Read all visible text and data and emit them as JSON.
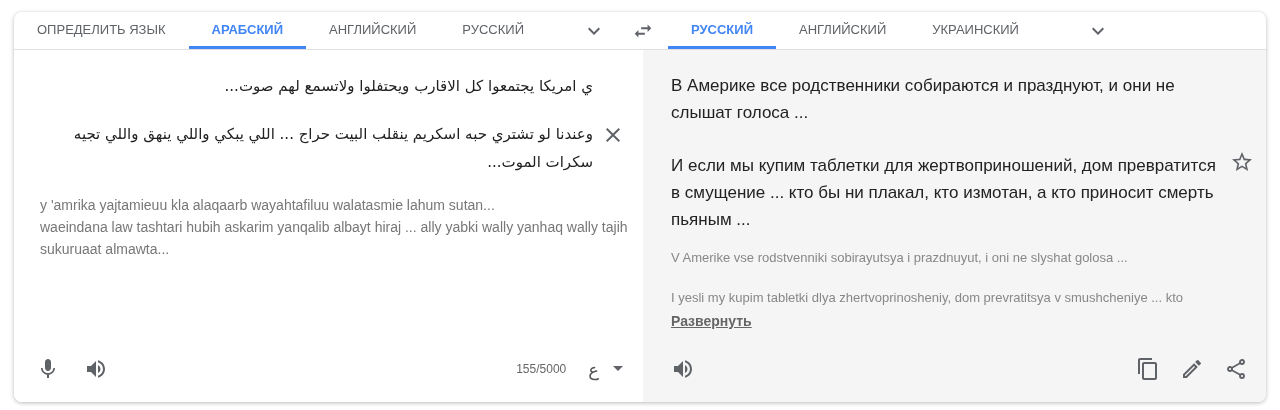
{
  "source_tabs": [
    {
      "label": "ОПРЕДЕЛИТЬ ЯЗЫК",
      "selected": false
    },
    {
      "label": "АРАБСКИЙ",
      "selected": true
    },
    {
      "label": "АНГЛИЙСКИЙ",
      "selected": false
    },
    {
      "label": "РУССКИЙ",
      "selected": false
    }
  ],
  "target_tabs": [
    {
      "label": "РУССКИЙ",
      "selected": true
    },
    {
      "label": "АНГЛИЙСКИЙ",
      "selected": false
    },
    {
      "label": "УКРАИНСКИЙ",
      "selected": false
    }
  ],
  "source": {
    "paragraphs": [
      "ي امريكا يجتمعوا كل الاقارب ويحتفلوا  ولاتسمع لهم صوت...",
      "وعندنا لو تشتري حبه اسكريم ينقلب البيت حراج ... اللي يبكي واللي ينهق  واللي تجيه سكرات الموت..."
    ],
    "transliteration": [
      "y 'amrika yajtamieuu kla alaqaarb wayahtafiluu walatasmie lahum sutan...",
      "waeindana law tashtari hubih askarim yanqalib albayt hiraj ... ally yabki wally yanhaq wally tajih sukuruaat almawta..."
    ],
    "char_count": "155/5000",
    "input_tool": "ع"
  },
  "target": {
    "paragraphs": [
      "В Америке все родственники собираются и празднуют, и они не слышат голоса ...",
      "И если мы купим таблетки для жертвоприношений, дом превратится в смущение ... кто бы ни плакал, кто измотан, а кто приносит смерть пьяным ..."
    ],
    "transliteration": [
      "V Amerike vse rodstvenniki sobirayutsya i prazdnuyut, i oni ne slyshat golosa ...",
      "I yesli my kupim tabletki dlya zhertvoprinosheniy, dom prevratitsya v smushcheniye ... kto"
    ],
    "expand_link": "Развернуть"
  }
}
